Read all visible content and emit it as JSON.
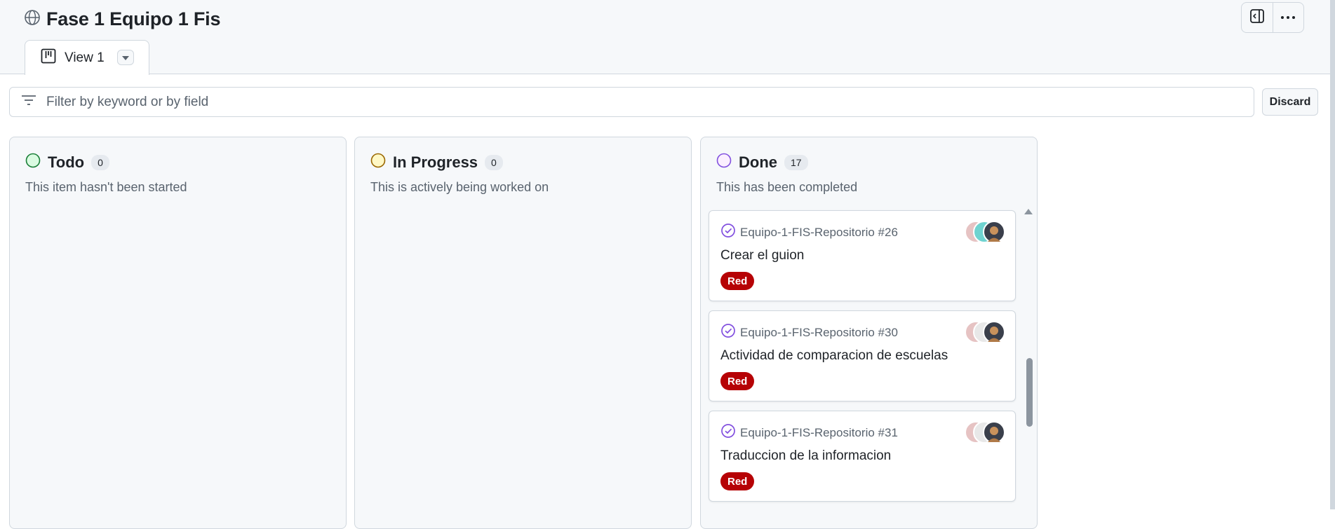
{
  "header": {
    "title": "Fase 1 Equipo 1 Fis"
  },
  "tabs": [
    {
      "label": "View 1"
    }
  ],
  "filter": {
    "placeholder": "Filter by keyword or by field"
  },
  "actions": {
    "discard_label": "Discard"
  },
  "columns": [
    {
      "title": "Todo",
      "count": "0",
      "description": "This item hasn't been started",
      "status_color": "#1a7f37"
    },
    {
      "title": "In Progress",
      "count": "0",
      "description": "This is actively being worked on",
      "status_color": "#9a6700"
    },
    {
      "title": "Done",
      "count": "17",
      "description": "This has been completed",
      "status_color": "#8250df",
      "cards": [
        {
          "ref": "Equipo-1-FIS-Repositorio #26",
          "title": "Crear el guion",
          "label": "Red"
        },
        {
          "ref": "Equipo-1-FIS-Repositorio #30",
          "title": "Actividad de comparacion de escuelas",
          "label": "Red"
        },
        {
          "ref": "Equipo-1-FIS-Repositorio #31",
          "title": "Traduccion de la informacion",
          "label": "Red"
        }
      ]
    }
  ],
  "colors": {
    "label_red": "#b60205",
    "done_purple": "#8250df"
  },
  "icons": [
    "globe-icon",
    "sidebar-toggle-icon",
    "kebab-menu-icon",
    "board-view-icon",
    "caret-down-icon",
    "filter-icon",
    "closed-issue-icon",
    "avatar"
  ]
}
